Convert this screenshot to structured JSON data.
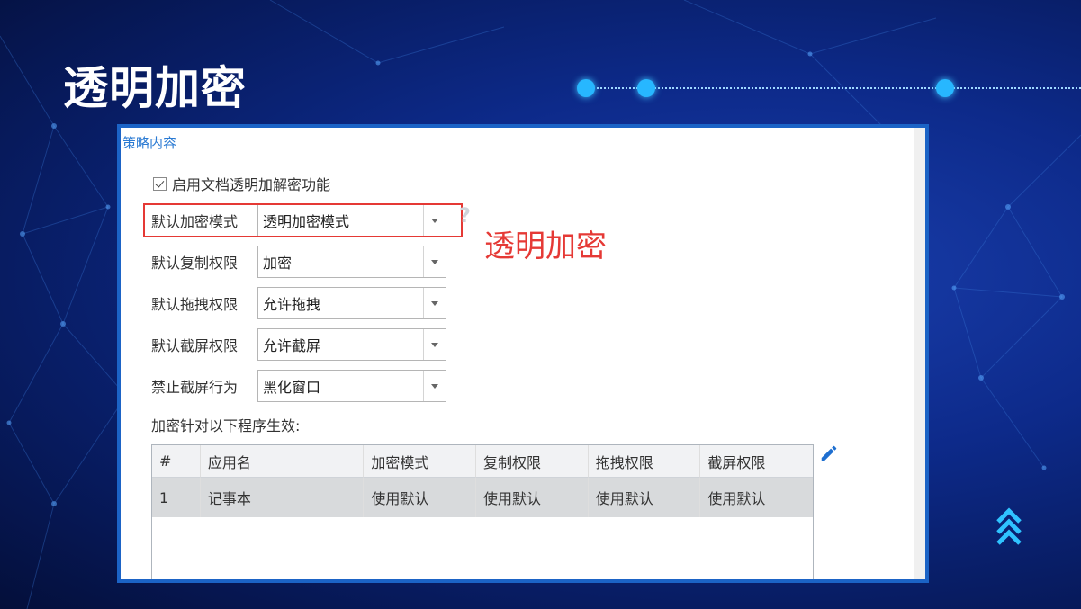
{
  "slide": {
    "title": "透明加密",
    "accent_color": "#27b7ff",
    "background_color": "#0d2a8a"
  },
  "panel": {
    "heading": "策略内容",
    "enable_checkbox": {
      "label": "启用文档透明加解密功能",
      "checked": true
    },
    "fields": [
      {
        "label": "默认加密模式",
        "value": "透明加密模式"
      },
      {
        "label": "默认复制权限",
        "value": "加密"
      },
      {
        "label": "默认拖拽权限",
        "value": "允许拖拽"
      },
      {
        "label": "默认截屏权限",
        "value": "允许截屏"
      },
      {
        "label": "禁止截屏行为",
        "value": "黑化窗口"
      }
    ],
    "annotation": {
      "text": "透明加密",
      "color": "#e53935"
    },
    "apply_label": "加密针对以下程序生效:",
    "table": {
      "columns": [
        "#",
        "应用名",
        "加密模式",
        "复制权限",
        "拖拽权限",
        "截屏权限"
      ],
      "rows": [
        [
          "1",
          "记事本",
          "使用默认",
          "使用默认",
          "使用默认",
          "使用默认"
        ]
      ]
    },
    "icons": {
      "edit": "pencil-icon",
      "help": "help-icon",
      "dropdown": "chevron-down-icon",
      "nav": "chevron-up-icon"
    }
  }
}
